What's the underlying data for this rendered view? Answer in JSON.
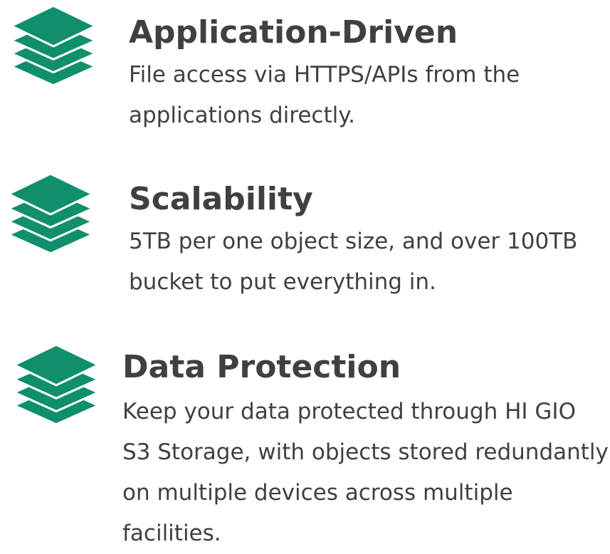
{
  "features": [
    {
      "icon": "stacked-layers-icon",
      "title": "Application-Driven",
      "description": "File access via HTTPS/APIs from the applications directly."
    },
    {
      "icon": "stacked-layers-icon",
      "title": "Scalability",
      "description": "5TB per one object size, and over 100TB bucket to put everything in."
    },
    {
      "icon": "stacked-layers-icon",
      "title": "Data Protection",
      "description": "Keep your data protected through HI GIO S3 Storage, with objects stored redundantly on multiple devices across multiple facilities."
    }
  ],
  "colors": {
    "icon": "#0f8f6c",
    "text": "#404040"
  }
}
